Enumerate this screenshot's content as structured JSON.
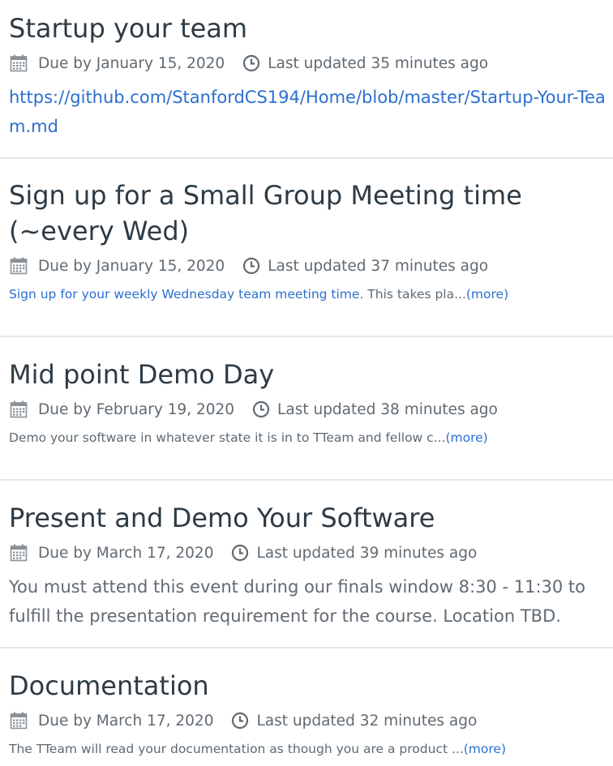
{
  "assignments": [
    {
      "title": "Startup your team",
      "due": "Due by January 15, 2020",
      "updated": "Last updated 35 minutes ago",
      "description": {
        "link_text": "https://github.com/StanfordCS194/Home/blob/master/Startup-Your-Team.md"
      }
    },
    {
      "title_line1": "Sign up for a Small Group Meeting time",
      "title_line2": "(~every Wed)",
      "due": "Due by January 15, 2020",
      "updated": "Last updated 37 minutes ago",
      "description": {
        "link_text": "Sign up for your weekly Wednesday team meeting time",
        "text": ". This takes pla...",
        "more": "(more)"
      }
    },
    {
      "title": "Mid point Demo Day",
      "due": "Due by February 19, 2020",
      "updated": "Last updated 38 minutes ago",
      "description": {
        "text": "Demo your software in whatever state it is in to TTeam and fellow c...",
        "more": "(more)"
      }
    },
    {
      "title": "Present and Demo Your Software",
      "due": "Due by March 17, 2020",
      "updated": "Last updated 39 minutes ago",
      "description": {
        "text": "You must attend this event during our finals window 8:30 - 11:30 to fulfill the presentation requirement for the course. Location TBD."
      }
    },
    {
      "title": "Documentation",
      "due": "Due by March 17, 2020",
      "updated": "Last updated 32 minutes ago",
      "description": {
        "text": "The TTeam will read your documentation as though you are a product ...",
        "more": "(more)"
      }
    }
  ],
  "icons": {
    "due": "calendar-icon",
    "updated": "clock-icon"
  },
  "colors": {
    "link": "#2b6fd0",
    "divider": "#e6e6e6",
    "title": "#2d3b45",
    "meta": "#616a72"
  }
}
